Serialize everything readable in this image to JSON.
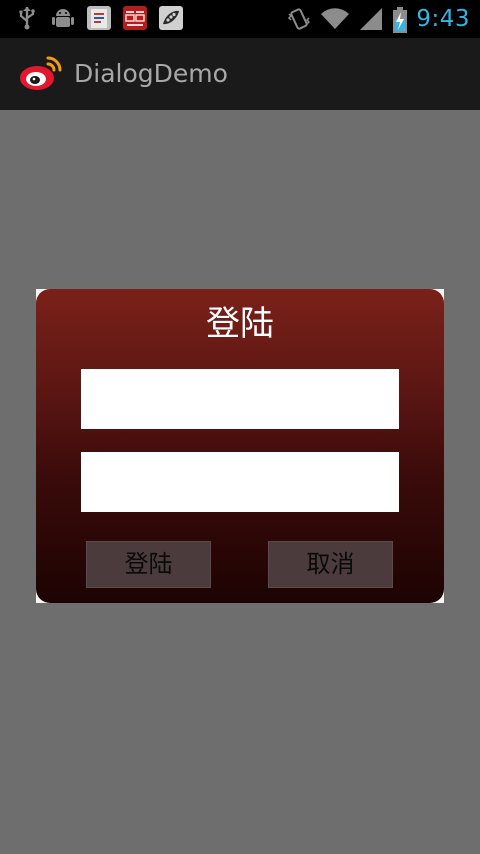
{
  "status_bar": {
    "time": "9:43",
    "left_icons": [
      "usb-icon",
      "android-debug-icon",
      "clipboard-app-icon",
      "netease-news-icon",
      "pea-app-icon"
    ],
    "right_icons": [
      "vibrate-icon",
      "wifi-icon",
      "cell-signal-icon",
      "battery-charging-icon"
    ]
  },
  "action_bar": {
    "title": "DialogDemo",
    "logo_icon": "weibo-logo-icon"
  },
  "dialog": {
    "title": "登陆",
    "username_value": "",
    "password_value": "",
    "login_label": "登陆",
    "cancel_label": "取消"
  },
  "colors": {
    "clock": "#33b5e5",
    "action_bar_bg": "#1a1a1a",
    "dim_background": "#6e6e6e",
    "dialog_top": "#7a2119",
    "dialog_bottom": "#1d0303",
    "button_bg": "#4b3b3c"
  }
}
